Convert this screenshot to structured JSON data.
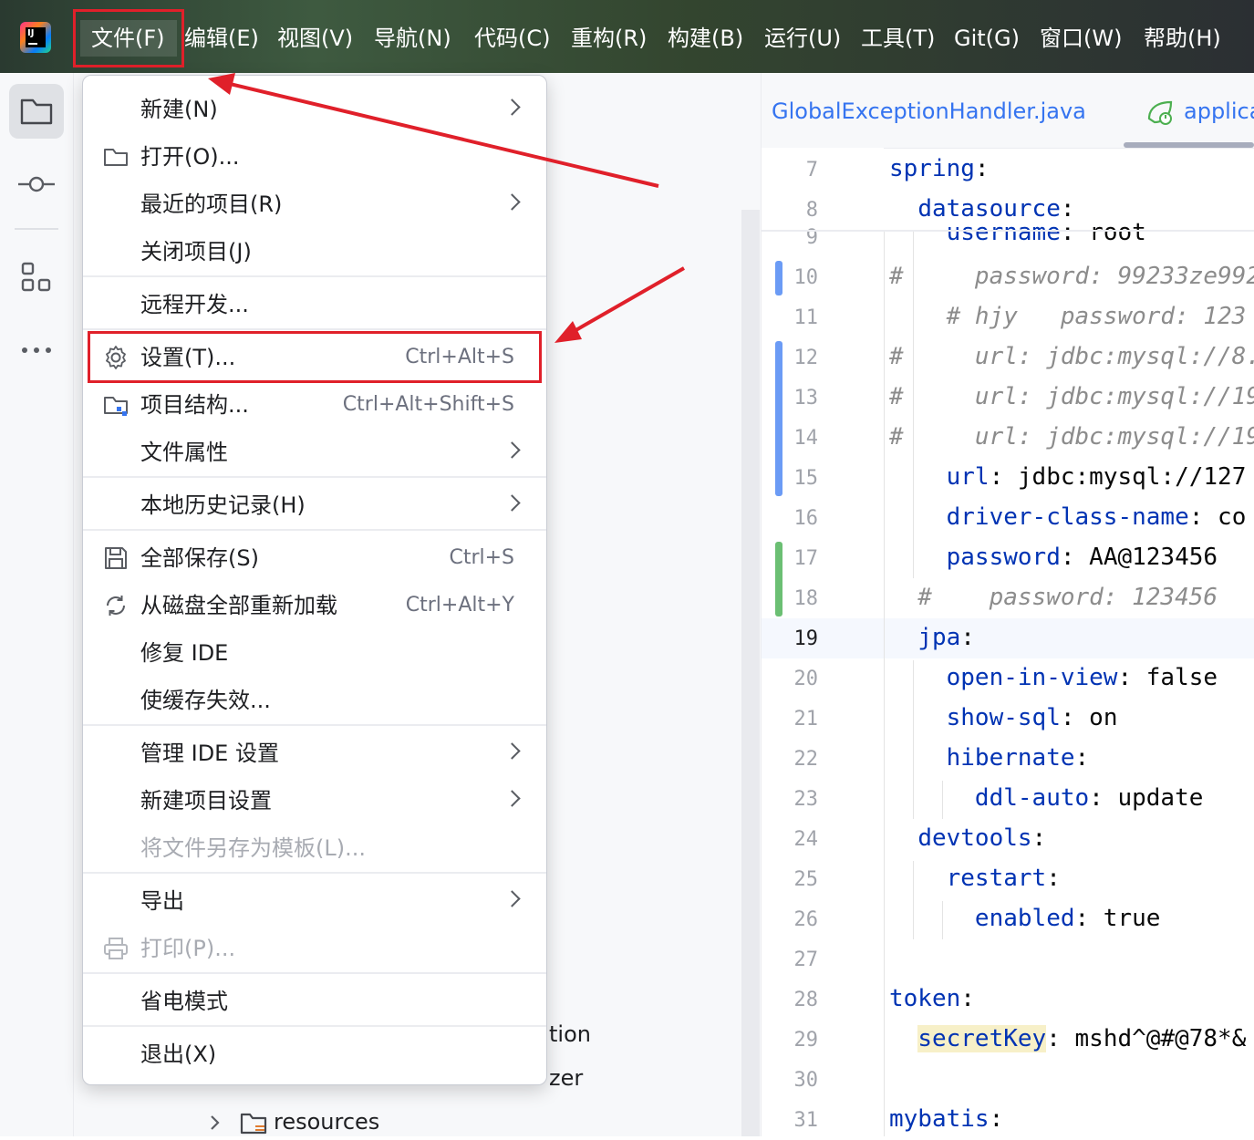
{
  "menubar": {
    "items": [
      "文件(F)",
      "编辑(E)",
      "视图(V)",
      "导航(N)",
      "代码(C)",
      "重构(R)",
      "构建(B)",
      "运行(U)",
      "工具(T)",
      "Git(G)",
      "窗口(W)",
      "帮助(H)"
    ],
    "active": "文件(F)"
  },
  "file_menu": {
    "items": [
      {
        "label": "新建(N)",
        "submenu": true
      },
      {
        "label": "打开(O)...",
        "icon": "folder-icon"
      },
      {
        "label": "最近的项目(R)",
        "submenu": true
      },
      {
        "label": "关闭项目(J)"
      },
      {
        "label": "远程开发..."
      },
      {
        "label": "设置(T)...",
        "shortcut": "Ctrl+Alt+S",
        "icon": "gear-icon",
        "highlighted": true
      },
      {
        "label": "项目结构...",
        "shortcut": "Ctrl+Alt+Shift+S",
        "icon": "project-structure-icon"
      },
      {
        "label": "文件属性",
        "submenu": true
      },
      {
        "label": "本地历史记录(H)",
        "submenu": true
      },
      {
        "label": "全部保存(S)",
        "shortcut": "Ctrl+S",
        "icon": "save-icon"
      },
      {
        "label": "从磁盘全部重新加载",
        "shortcut": "Ctrl+Alt+Y",
        "icon": "reload-icon"
      },
      {
        "label": "修复 IDE"
      },
      {
        "label": "使缓存失效..."
      },
      {
        "label": "管理 IDE 设置",
        "submenu": true
      },
      {
        "label": "新建项目设置",
        "submenu": true
      },
      {
        "label": "将文件另存为模板(L)...",
        "disabled": true
      },
      {
        "label": "导出",
        "submenu": true
      },
      {
        "label": "打印(P)...",
        "disabled": true,
        "icon": "print-icon"
      },
      {
        "label": "省电模式"
      },
      {
        "label": "退出(X)"
      }
    ]
  },
  "project_tree": {
    "partial_1": "tion",
    "partial_2": "zer",
    "resources": "resources"
  },
  "editor": {
    "tabs": [
      "GlobalExceptionHandler.java",
      "applica"
    ],
    "current_line": 19,
    "lines": [
      {
        "n": 7,
        "text": "spring:"
      },
      {
        "n": 8,
        "text": "  datasource:"
      },
      {
        "n": 9,
        "text": "    username: root"
      },
      {
        "n": 10,
        "text": "#     password: 99233ze992"
      },
      {
        "n": 11,
        "text": "    # hjy   password: 123"
      },
      {
        "n": 12,
        "text": "#     url: jdbc:mysql://8."
      },
      {
        "n": 13,
        "text": "#     url: jdbc:mysql://19"
      },
      {
        "n": 14,
        "text": "#     url: jdbc:mysql://19"
      },
      {
        "n": 15,
        "text": "    url: jdbc:mysql://127"
      },
      {
        "n": 16,
        "text": "    driver-class-name: co"
      },
      {
        "n": 17,
        "text": "    password: AA@123456"
      },
      {
        "n": 18,
        "text": "  #    password: 123456"
      },
      {
        "n": 19,
        "text": "  jpa:"
      },
      {
        "n": 20,
        "text": "    open-in-view: false"
      },
      {
        "n": 21,
        "text": "    show-sql: on"
      },
      {
        "n": 22,
        "text": "    hibernate:"
      },
      {
        "n": 23,
        "text": "      ddl-auto: update"
      },
      {
        "n": 24,
        "text": "  devtools:"
      },
      {
        "n": 25,
        "text": "    restart:"
      },
      {
        "n": 26,
        "text": "      enabled: true"
      },
      {
        "n": 27,
        "text": ""
      },
      {
        "n": 28,
        "text": "token:"
      },
      {
        "n": 29,
        "text": "  secretKey: mshd^@#@78*&"
      },
      {
        "n": 30,
        "text": ""
      },
      {
        "n": 31,
        "text": "mybatis:"
      }
    ]
  },
  "colors": {
    "accent": "#3574f0",
    "annotation_red": "#e0202a",
    "yaml_key": "#0033b3",
    "comment": "#8c8c8c",
    "vcs_modified": "#6b9bf5",
    "vcs_added": "#6bbf73"
  }
}
